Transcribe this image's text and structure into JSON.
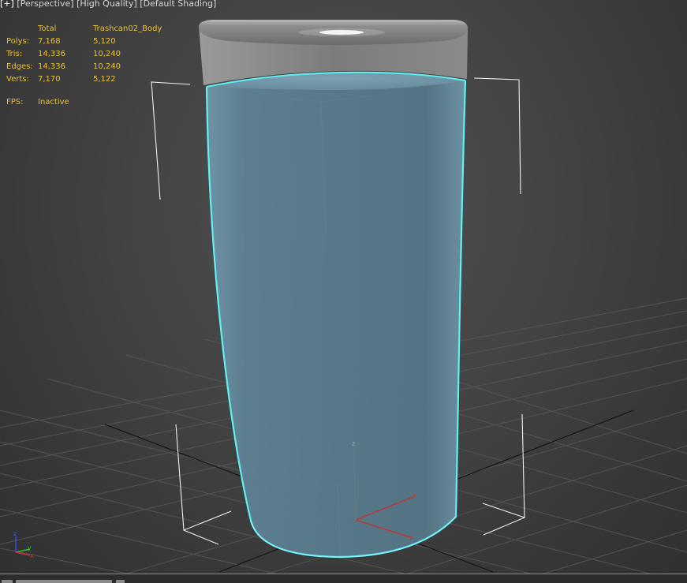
{
  "viewport": {
    "label_parts": [
      "[+]",
      " [Perspective]",
      " [High Quality]",
      " [Default Shading]"
    ]
  },
  "stats": {
    "header": {
      "c0": "",
      "c1": "Total",
      "c2": "Trashcan02_Body"
    },
    "rows": [
      {
        "c0": "Polys:",
        "c1": "7,168",
        "c2": "5,120"
      },
      {
        "c0": "Tris:",
        "c1": "14,336",
        "c2": "10,240"
      },
      {
        "c0": "Edges:",
        "c1": "14,336",
        "c2": "10,240"
      },
      {
        "c0": "Verts:",
        "c1": "7,170",
        "c2": "5,122"
      }
    ],
    "fps": {
      "label": "FPS:",
      "value": "Inactive"
    }
  },
  "gizmo": {
    "x": "x",
    "y": "y",
    "z": "z"
  },
  "view_axis": {
    "x": "x",
    "y": "y",
    "z": "z"
  },
  "colors": {
    "stats_text": "#e8c038",
    "selection_outline": "#5ff0f5",
    "object_fill": "#5a7a8c",
    "lid": "#8c8c8c",
    "grid": "#555555",
    "bounding_box": "#f0f0f0",
    "axis_x": "#d03030",
    "axis_y": "#30c030",
    "axis_z": "#3050e0"
  }
}
